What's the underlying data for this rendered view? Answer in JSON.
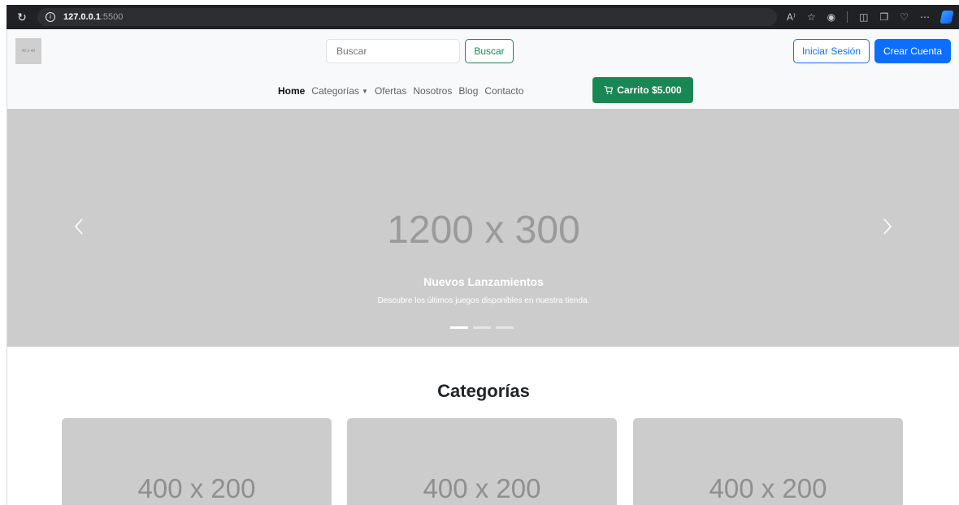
{
  "browser": {
    "reload_icon": "reload-icon",
    "url_host": "127.0.0.1",
    "url_port": ":5500"
  },
  "header": {
    "logo_text": "40 x 40",
    "search_placeholder": "Buscar",
    "search_button": "Buscar",
    "login_button": "Iniciar Sesión",
    "signup_button": "Crear Cuenta"
  },
  "nav": {
    "items": [
      {
        "label": "Home"
      },
      {
        "label": "Categorías"
      },
      {
        "label": "Ofertas"
      },
      {
        "label": "Nosotros"
      },
      {
        "label": "Blog"
      },
      {
        "label": "Contacto"
      }
    ],
    "cart_label": "Carrito $5.000"
  },
  "carousel": {
    "placeholder": "1200 x 300",
    "caption_title": "Nuevos Lanzamientos",
    "caption_text": "Descubre los últimos juegos disponibles en nuestra tienda."
  },
  "categories": {
    "title": "Categorías",
    "cards": [
      {
        "placeholder": "400 x 200"
      },
      {
        "placeholder": "400 x 200"
      },
      {
        "placeholder": "400 x 200"
      }
    ]
  },
  "colors": {
    "primary": "#0d6efd",
    "success": "#198754",
    "placeholder_gray": "#cccccc"
  }
}
